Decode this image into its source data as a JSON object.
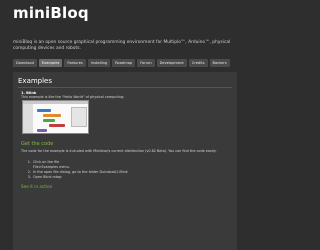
{
  "site": {
    "title": "miniBloq",
    "tagline": "miniBloq is an open source graphical programming environment for Multiplo™, Arduino™, physical computing devices and robots."
  },
  "nav": {
    "tabs": [
      "Download",
      "Examples",
      "Features",
      "Installing",
      "Roadmap",
      "Forum",
      "Development",
      "Credits",
      "Backers"
    ],
    "active_index": 1
  },
  "content": {
    "heading": "Examples",
    "item_title": "1. Blink",
    "item_desc": "This example is like the \"Hello World\" of physical computing:",
    "code_link": "Get the code",
    "paragraph": "The code for the example is included with Minibloq's current distribution (v0.82 Beta). You can find the code easily:",
    "steps": [
      "Click on the file",
      "File>Examples menu.",
      "In the open file dialog, go to the folder Duinobot/1.Blink",
      "Open Blink.mbqc"
    ],
    "action_link": "See it in action"
  }
}
